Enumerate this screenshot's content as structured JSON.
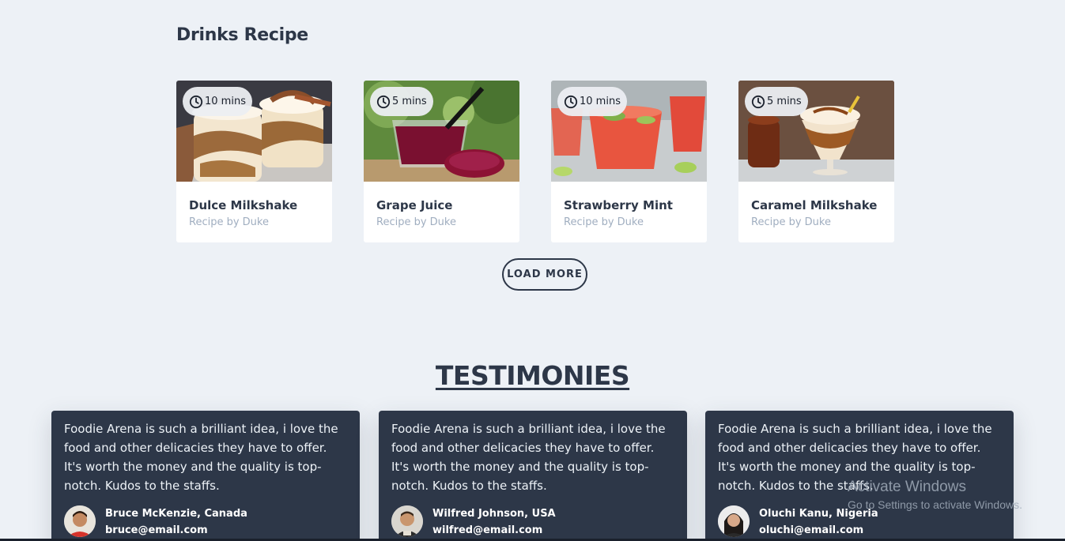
{
  "drinks": {
    "title": "Drinks Recipe",
    "cards": [
      {
        "time": "10 mins",
        "name": "Dulce Milkshake",
        "author": "Recipe by Duke"
      },
      {
        "time": "5 mins",
        "name": "Grape Juice",
        "author": "Recipe by Duke"
      },
      {
        "time": "10 mins",
        "name": "Strawberry Mint",
        "author": "Recipe by Duke"
      },
      {
        "time": "5 mins",
        "name": "Caramel Milkshake",
        "author": "Recipe by Duke"
      }
    ],
    "load_more_label": "LOAD MORE"
  },
  "testimonies": {
    "title": "TESTIMONIES",
    "items": [
      {
        "quote": "Foodie Arena is such a brilliant idea, i love the food and other delicacies they have to offer. It's worth the money and the quality is top-notch. Kudos to the staffs.",
        "name": "Bruce McKenzie, Canada",
        "email": "bruce@email.com"
      },
      {
        "quote": "Foodie Arena is such a brilliant idea, i love the food and other delicacies they have to offer. It's worth the money and the quality is top-notch. Kudos to the staffs.",
        "name": "Wilfred Johnson, USA",
        "email": "wilfred@email.com"
      },
      {
        "quote": "Foodie Arena is such a brilliant idea, i love the food and other delicacies they have to offer. It's worth the money and the quality is top-notch. Kudos to the staffs.",
        "name": "Oluchi Kanu, Nigeria",
        "email": "oluchi@email.com"
      }
    ]
  },
  "watermark": {
    "line1": "Activate Windows",
    "line2": "Go to Settings to activate Windows."
  },
  "colors": {
    "background": "#edf1f6",
    "text_dark": "#2d3748",
    "card_dark": "#2d3748",
    "muted": "#a0aec0"
  }
}
